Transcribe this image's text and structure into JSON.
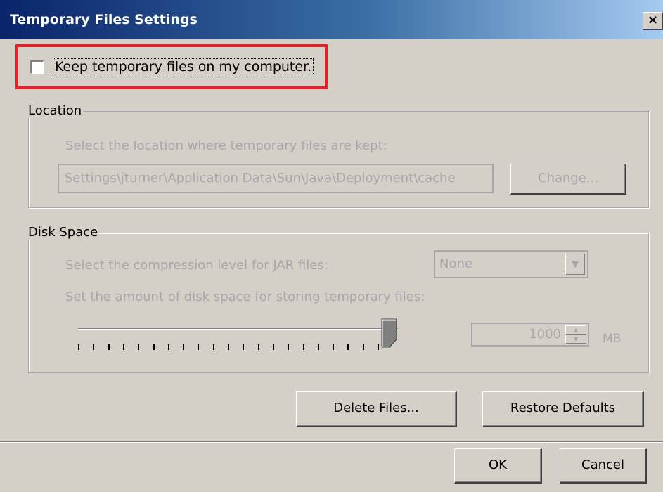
{
  "window": {
    "title": "Temporary Files Settings",
    "close_glyph": "×",
    "accent_color": "#0a246a",
    "highlight_color": "#ee1c24"
  },
  "keep_files": {
    "label": "Keep temporary files on my computer.",
    "checked": false
  },
  "location": {
    "legend": "Location",
    "description": "Select the location where temporary files are kept:",
    "path_value": "Settings\\jturner\\Application Data\\Sun\\Java\\Deployment\\cache",
    "change_button": {
      "mnemonic": "h",
      "pre": "C",
      "post": "ange..."
    }
  },
  "disk_space": {
    "legend": "Disk Space",
    "compression_description": "Select the compression level for JAR files:",
    "compression_value": "None",
    "space_description": "Set the amount of disk space for storing temporary files:",
    "slider_level": 1.0,
    "size_value": "1000",
    "unit": "MB"
  },
  "actions": {
    "delete_button": {
      "mnemonic": "D",
      "rest": "elete Files..."
    },
    "restore_button": {
      "mnemonic": "R",
      "rest": "estore Defaults"
    }
  },
  "footer": {
    "ok_label": "OK",
    "cancel_label": "Cancel"
  }
}
